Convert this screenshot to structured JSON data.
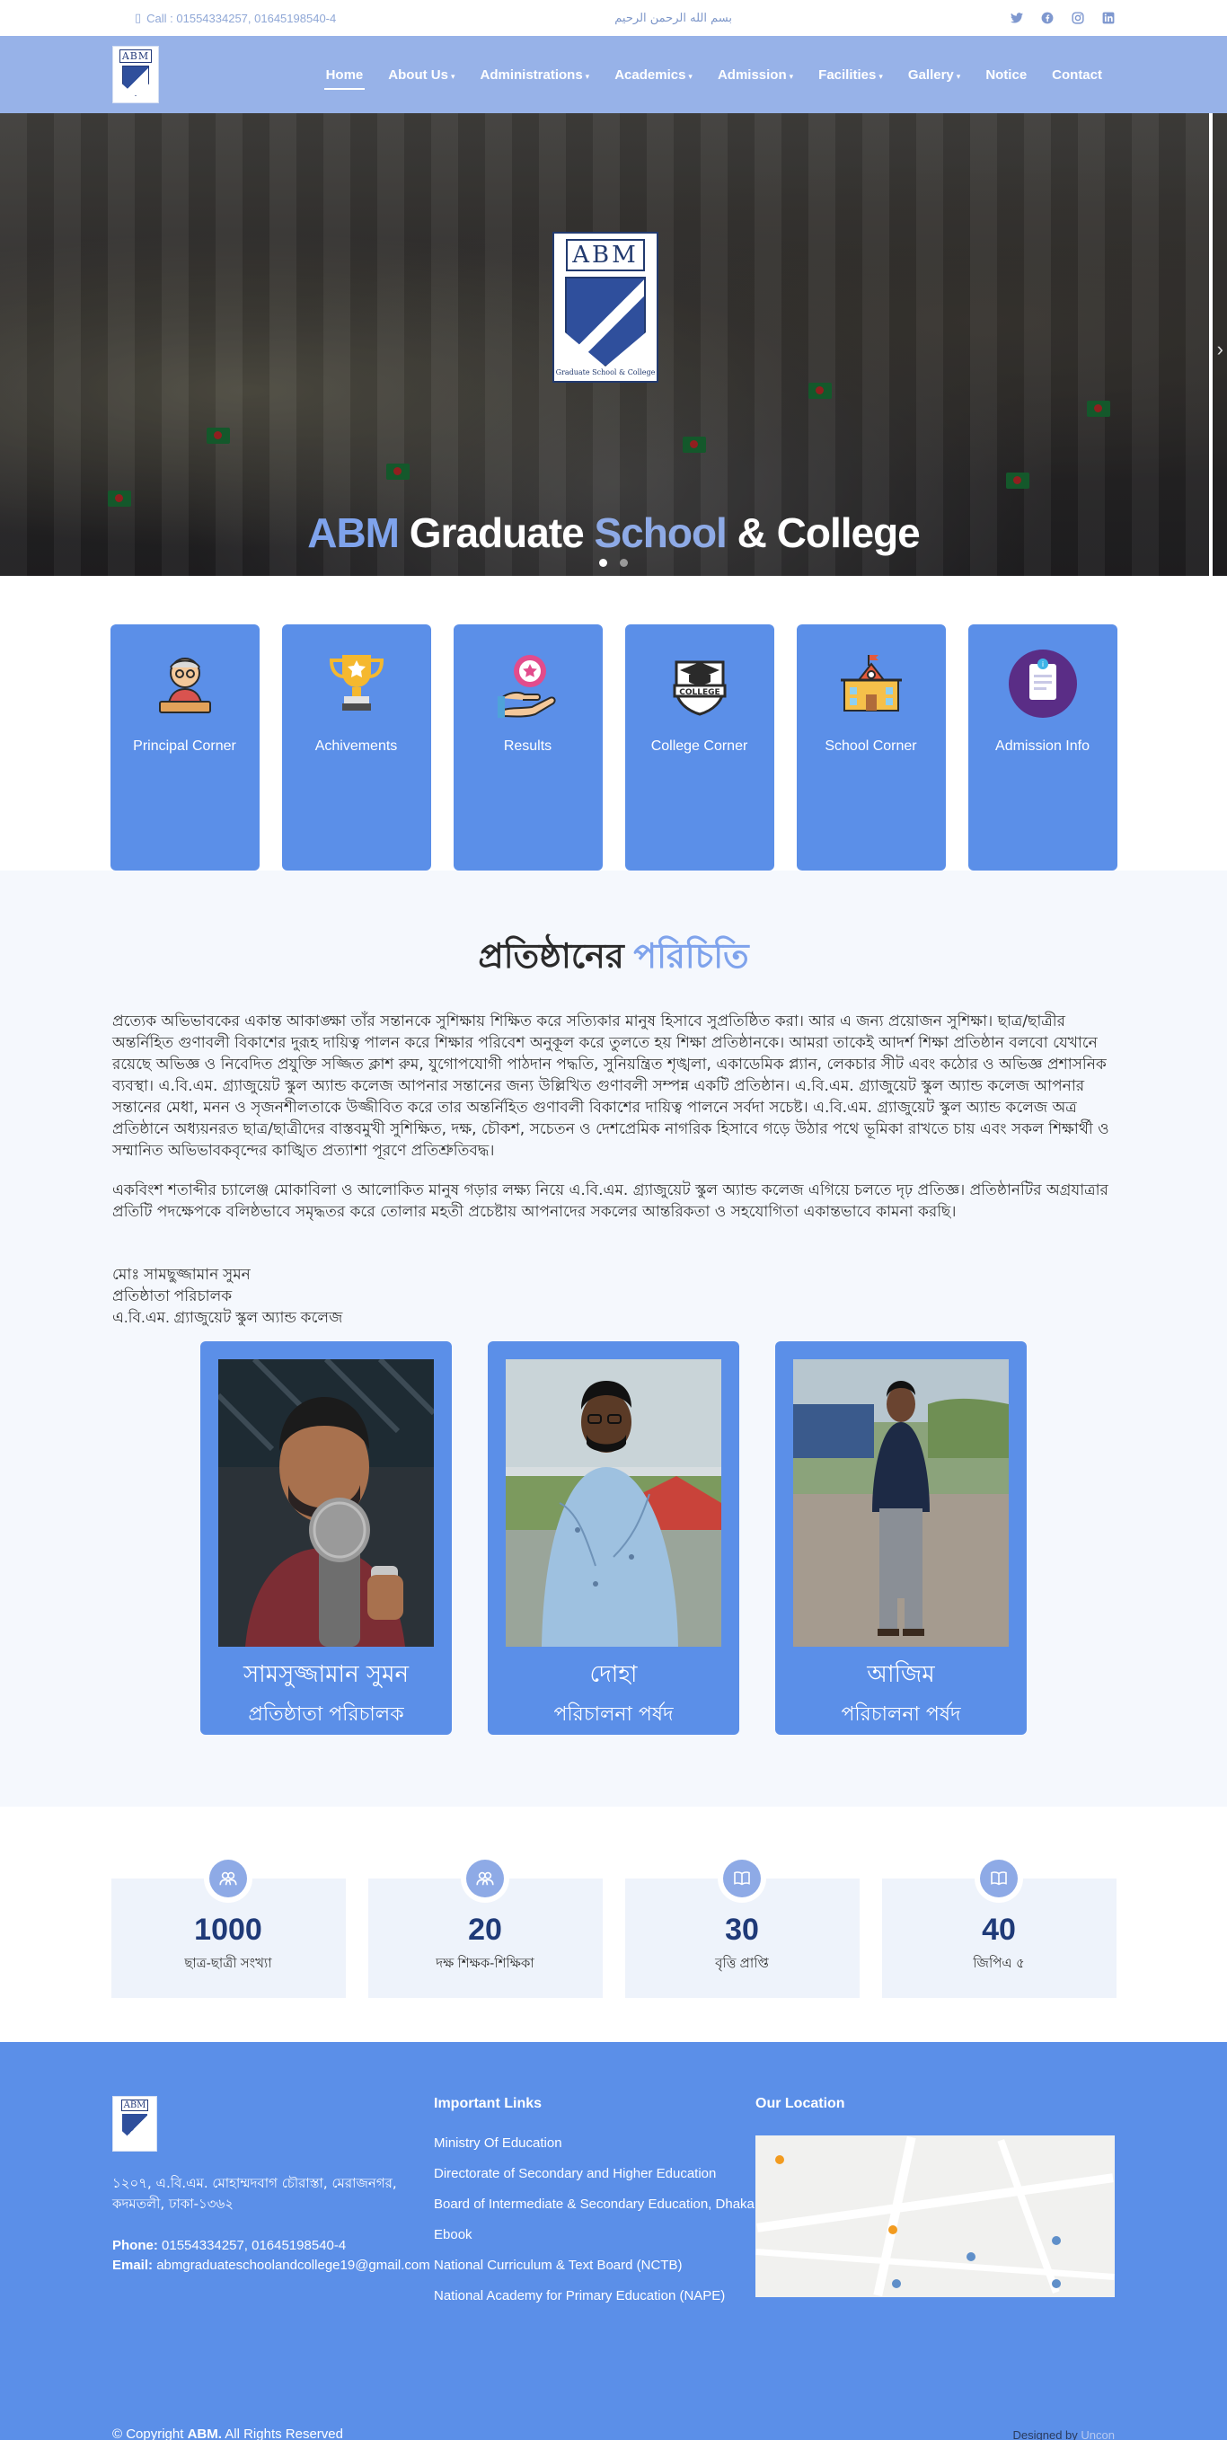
{
  "topbar": {
    "call": "Call : 01554334257, 01645198540-4",
    "bismillah": "بسم الله الرحمن الرحيم",
    "socials": [
      "twitter-icon",
      "facebook-icon",
      "instagram-icon",
      "linkedin-icon"
    ]
  },
  "nav": {
    "items": [
      {
        "label": "Home",
        "dropdown": false
      },
      {
        "label": "About Us",
        "dropdown": true
      },
      {
        "label": "Administrations",
        "dropdown": true
      },
      {
        "label": "Academics",
        "dropdown": true
      },
      {
        "label": "Admission",
        "dropdown": true
      },
      {
        "label": "Facilities",
        "dropdown": true
      },
      {
        "label": "Gallery",
        "dropdown": true
      },
      {
        "label": "Notice",
        "dropdown": false
      },
      {
        "label": "Contact",
        "dropdown": false
      }
    ]
  },
  "hero": {
    "crest_text": "ABM",
    "crest_motto": "Graduate School & College",
    "title_w1": "ABM",
    "title_w2": "Graduate",
    "title_w3": "School",
    "title_w4": "& College"
  },
  "quick": [
    {
      "label": "Principal Corner",
      "icon": "principal-icon"
    },
    {
      "label": "Achivements",
      "icon": "trophy-icon"
    },
    {
      "label": "Results",
      "icon": "results-icon"
    },
    {
      "label": "College Corner",
      "icon": "college-icon"
    },
    {
      "label": "School Corner",
      "icon": "school-icon"
    },
    {
      "label": "Admission Info",
      "icon": "admission-icon"
    }
  ],
  "intro": {
    "title_main": "প্রতিষ্ঠানের",
    "title_accent": "পরিচিতি",
    "para1": "প্রত্যেক অভিভাবকের একান্ত আকাঙ্ক্ষা তাঁর সন্তানকে সুশিক্ষায় শিক্ষিত করে সত্যিকার মানুষ হিসাবে সুপ্রতিষ্ঠিত করা। আর এ জন্য প্রয়োজন সুশিক্ষা। ছাত্র/ছাত্রীর অন্তর্নিহিত গুণাবলী বিকাশের দুরূহ দায়িত্ব পালন করে শিক্ষার পরিবেশ অনুকূল করে তুলতে হয় শিক্ষা প্রতিষ্ঠানকে। আমরা তাকেই আদর্শ শিক্ষা প্রতিষ্ঠান বলবো যেখানে রয়েছে অভিজ্ঞ ও নিবেদিত প্রযুক্তি সজ্জিত ক্লাশ রুম, যুগোপযোগী পাঠদান পদ্ধতি, সুনিয়ন্ত্রিত শৃঙ্খলা, একাডেমিক প্ল্যান, লেকচার সীট এবং কঠোর ও অভিজ্ঞ প্রশাসনিক ব্যবস্থা। এ.বি.এম. গ্র্যাজুয়েট স্কুল অ্যান্ড কলেজ আপনার সন্তানের জন্য উল্লিখিত গুণাবলী সম্পন্ন একটি প্রতিষ্ঠান। এ.বি.এম. গ্র্যাজুয়েট স্কুল অ্যান্ড কলেজ আপনার সন্তানের মেধা, মনন ও সৃজনশীলতাকে উজ্জীবিত করে তার অন্তর্নিহিত গুণাবলী বিকাশের দায়িত্ব পালনে সর্বদা সচেষ্ট। এ.বি.এম. গ্র্যাজুয়েট স্কুল অ্যান্ড কলেজ অত্র প্রতিষ্ঠানে অধ্যয়নরত ছাত্র/ছাত্রীদের বাস্তবমুখী সুশিক্ষিত, দক্ষ, চৌকশ, সচেতন ও দেশপ্রেমিক নাগরিক হিসাবে গড়ে উঠার পথে ভূমিকা রাখতে চায় এবং সকল শিক্ষার্থী ও সম্মানিত অভিভাবকবৃন্দের কাঙ্খিত প্রত্যাশা পূরণে প্রতিশ্রুতিবদ্ধ।",
    "para2": "একবিংশ শতাব্দীর চ্যালেঞ্জ মোকাবিলা ও আলোকিত মানুষ গড়ার লক্ষ্য নিয়ে এ.বি.এম. গ্র্যাজুয়েট স্কুল অ্যান্ড কলেজ এগিয়ে চলতে দৃঢ় প্রতিজ্ঞ। প্রতিষ্ঠানটির অগ্রযাত্রার প্রতিটি পদক্ষেপকে বলিষ্ঠভাবে সমৃদ্ধতর করে তোলার মহতী প্রচেষ্টায় আপনাদের সকলের আন্তরিকতা ও সহযোগিতা একান্তভাবে কামনা করছি।",
    "sign_name": "মোঃ সামছুজ্জামান সুমন",
    "sign_role": "প্রতিষ্ঠাতা পরিচালক",
    "sign_org": "এ.বি.এম. গ্র্যাজুয়েট স্কুল অ্যান্ড কলেজ"
  },
  "people": [
    {
      "name": "সামসুজ্জামান সুমন",
      "role": "প্রতিষ্ঠাতা পরিচালক"
    },
    {
      "name": "দোহা",
      "role": "পরিচালনা পর্ষদ"
    },
    {
      "name": "আজিম",
      "role": "পরিচালনা পর্ষদ"
    }
  ],
  "stats": [
    {
      "value": "1000",
      "label": "ছাত্র-ছাত্রী সংখ্যা",
      "icon": "users-icon"
    },
    {
      "value": "20",
      "label": "দক্ষ শিক্ষক-শিক্ষিকা",
      "icon": "users-icon"
    },
    {
      "value": "30",
      "label": "বৃত্তি প্রাপ্তি",
      "icon": "book-icon"
    },
    {
      "value": "40",
      "label": "জিপিএ ৫",
      "icon": "book-icon"
    }
  ],
  "footer": {
    "logo_text": "ABM",
    "address": "১২০৭, এ.বি.এম. মোহাম্মদবাগ চৌরাস্তা, মেরাজনগর, কদমতলী, ঢাকা-১৩৬২",
    "phone_label": "Phone:",
    "phone": "01554334257, 01645198540-4",
    "email_label": "Email:",
    "email": "abmgraduateschoolandcollege19@gmail.com",
    "links_heading": "Important Links",
    "links": [
      "Ministry Of Education",
      "Directorate of Secondary and Higher Education",
      "Board of Intermediate & Secondary Education, Dhaka",
      "Ebook",
      "National Curriculum & Text Board (NCTB)",
      "National Academy for Primary Education (NAPE)"
    ],
    "location_heading": "Our Location",
    "copyright_prefix": "© Copyright",
    "copyright_brand": "ABM.",
    "copyright_suffix": "All Rights Reserved",
    "designed_prefix": "Designed by",
    "designed_by": "Uncon"
  },
  "colors": {
    "primary": "#5b8fe8",
    "nav": "#97b2e8",
    "accent": "#7fa3ec",
    "light_bg": "#f5f8fd"
  }
}
